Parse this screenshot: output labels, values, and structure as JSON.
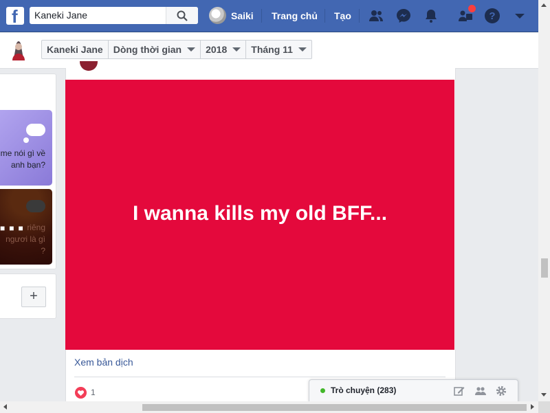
{
  "topbar": {
    "search_value": "Kaneki Jane",
    "user_name": "Saiki",
    "nav_home": "Trang chủ",
    "nav_create": "Tạo"
  },
  "subbar": {
    "crumbs": [
      "Kaneki Jane",
      "Dòng thời gian",
      "2018",
      "Tháng 11"
    ]
  },
  "left": {
    "tile1_text": "me nói gì về\nanh bạn?",
    "tile2_text": "riêng\nngươi là gì\n?",
    "add_label": "+"
  },
  "post": {
    "banner_text": "I wanna kills my old BFF...",
    "banner_color": "#e4093c",
    "translate_link": "Xem bản dịch",
    "reaction_count": "1"
  },
  "chat": {
    "label": "Trò chuyện (283)",
    "status_color": "#42b72a"
  },
  "colors": {
    "brand": "#4267b2"
  }
}
